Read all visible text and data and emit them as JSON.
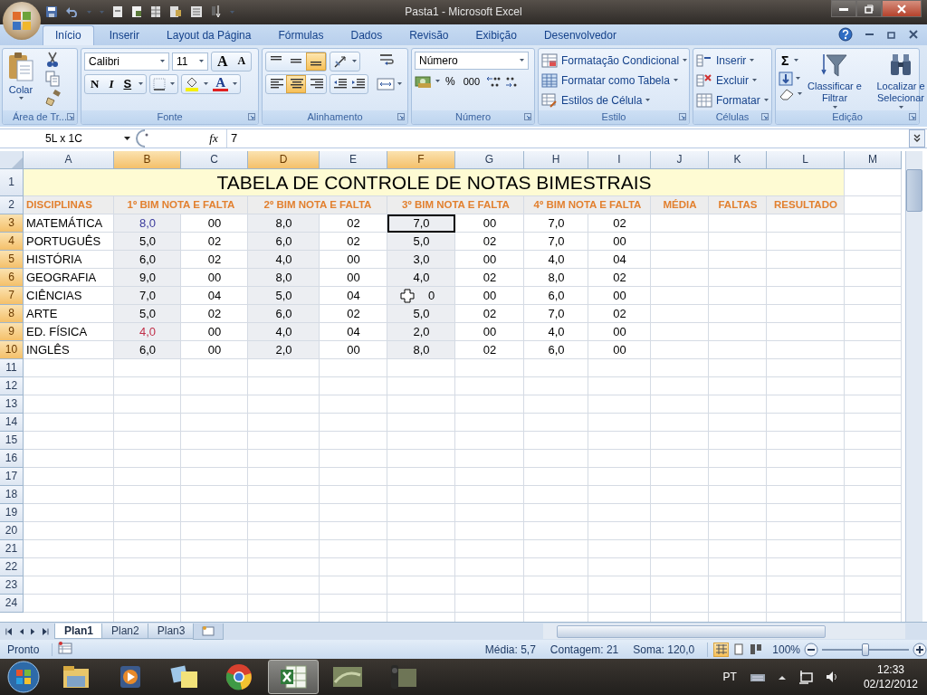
{
  "window": {
    "title": "Pasta1 - Microsoft Excel"
  },
  "ribbon_tabs": [
    {
      "label": "Início",
      "selected": true
    },
    {
      "label": "Inserir",
      "selected": false
    },
    {
      "label": "Layout da Página",
      "selected": false
    },
    {
      "label": "Fórmulas",
      "selected": false
    },
    {
      "label": "Dados",
      "selected": false
    },
    {
      "label": "Revisão",
      "selected": false
    },
    {
      "label": "Exibição",
      "selected": false
    },
    {
      "label": "Desenvolvedor",
      "selected": false
    }
  ],
  "clipboard": {
    "label": "Área de Tr...",
    "paste": "Colar"
  },
  "font": {
    "label": "Fonte",
    "name": "Calibri",
    "size": "11",
    "grow": "A",
    "shrink": "A",
    "bold": "N",
    "italic": "I",
    "underline": "S",
    "color_letter": "A"
  },
  "alignment": {
    "label": "Alinhamento",
    "vertical": [
      {
        "selected": false
      },
      {
        "selected": false
      },
      {
        "selected": true
      }
    ],
    "horizontal": [
      {
        "selected": false
      },
      {
        "selected": true
      },
      {
        "selected": false
      }
    ]
  },
  "number": {
    "label": "Número",
    "format": "Número",
    "percent": "%",
    "thousands": "000"
  },
  "styles": {
    "label": "Estilo",
    "items": [
      "Formatação Condicional",
      "Formatar como Tabela",
      "Estilos de Célula"
    ]
  },
  "cells": {
    "label": "Células",
    "items": [
      "Inserir",
      "Excluir",
      "Formatar"
    ]
  },
  "editing": {
    "label": "Edição",
    "sum": "Σ",
    "sort": "Classificar e Filtrar",
    "find": "Localizar e Selecionar"
  },
  "formula_bar": {
    "name_box": "5L x 1C",
    "function": "fx",
    "value": "7"
  },
  "sheet": {
    "columns": [
      {
        "label": "A",
        "selected": false
      },
      {
        "label": "B",
        "selected": true
      },
      {
        "label": "C",
        "selected": false
      },
      {
        "label": "D",
        "selected": true
      },
      {
        "label": "E",
        "selected": false
      },
      {
        "label": "F",
        "selected": true
      },
      {
        "label": "G",
        "selected": false
      },
      {
        "label": "H",
        "selected": false
      },
      {
        "label": "I",
        "selected": false
      },
      {
        "label": "J",
        "selected": false
      },
      {
        "label": "K",
        "selected": false
      },
      {
        "label": "L",
        "selected": false
      },
      {
        "label": "M",
        "selected": false
      }
    ],
    "rows": [
      {
        "number": "1",
        "selected": false,
        "kind": "title",
        "cells": [
          "TABELA DE CONTROLE DE NOTAS BIMESTRAIS"
        ]
      },
      {
        "number": "2",
        "selected": false,
        "kind": "header",
        "cells": [
          "DISCIPLINAS",
          {
            "text": "1º BIM  NOTA E FALTA",
            "kind": "merged"
          },
          {
            "text": "2º BIM  NOTA E FALTA",
            "kind": "merged"
          },
          {
            "text": "3º BIM  NOTA E FALTA",
            "kind": "merged"
          },
          {
            "text": "4º BIM  NOTA E FALTA",
            "kind": "merged"
          },
          "MÉDIA",
          "FALTAS",
          "RESULTADO"
        ]
      },
      {
        "number": "3",
        "selected": true,
        "kind": "data",
        "cells": [
          "MATEMÁTICA",
          {
            "text": "8,0",
            "color": "#3b3b9c"
          },
          "00",
          "8,0",
          "02",
          {
            "text": "7,0",
            "active": true
          },
          "00",
          "7,0",
          "02"
        ]
      },
      {
        "number": "4",
        "selected": true,
        "kind": "data",
        "cells": [
          "PORTUGUÊS",
          "5,0",
          "02",
          "6,0",
          "02",
          "5,0",
          "02",
          "7,0",
          "00"
        ]
      },
      {
        "number": "5",
        "selected": true,
        "kind": "data",
        "cells": [
          "HISTÓRIA",
          "6,0",
          "02",
          "4,0",
          "00",
          "3,0",
          "00",
          "4,0",
          "04"
        ]
      },
      {
        "number": "6",
        "selected": true,
        "kind": "data",
        "cells": [
          "GEOGRAFIA",
          "9,0",
          "00",
          "8,0",
          "00",
          "4,0",
          "02",
          "8,0",
          "02"
        ]
      },
      {
        "number": "7",
        "selected": true,
        "kind": "data",
        "cells": [
          "CIÊNCIAS",
          "7,0",
          "04",
          "5,0",
          "04",
          {
            "text": "0",
            "cursor": true
          },
          "00",
          "6,0",
          "00"
        ]
      },
      {
        "number": "8",
        "selected": true,
        "kind": "data",
        "cells": [
          "ARTE",
          "5,0",
          "02",
          "6,0",
          "02",
          "5,0",
          "02",
          "7,0",
          "02"
        ]
      },
      {
        "number": "9",
        "selected": true,
        "kind": "data",
        "cells": [
          "ED. FÍSICA",
          {
            "text": "4,0",
            "color": "#c0304a"
          },
          "00",
          "4,0",
          "04",
          "2,0",
          "00",
          "4,0",
          "00"
        ]
      },
      {
        "number": "10",
        "selected": true,
        "kind": "data",
        "cells": [
          "INGLÊS",
          "6,0",
          "00",
          "2,0",
          "00",
          "8,0",
          "02",
          "6,0",
          "00"
        ]
      },
      {
        "number": "11",
        "selected": false,
        "kind": "data"
      },
      {
        "number": "12",
        "selected": false,
        "kind": "data"
      },
      {
        "number": "13",
        "selected": false,
        "kind": "data"
      },
      {
        "number": "14",
        "selected": false,
        "kind": "data"
      },
      {
        "number": "15",
        "selected": false,
        "kind": "data"
      },
      {
        "number": "16",
        "selected": false,
        "kind": "data"
      },
      {
        "number": "17",
        "selected": false,
        "kind": "data"
      },
      {
        "number": "18",
        "selected": false,
        "kind": "data"
      },
      {
        "number": "19",
        "selected": false,
        "kind": "data"
      },
      {
        "number": "20",
        "selected": false,
        "kind": "data"
      },
      {
        "number": "21",
        "selected": false,
        "kind": "data"
      },
      {
        "number": "22",
        "selected": false,
        "kind": "data"
      },
      {
        "number": "23",
        "selected": false,
        "kind": "data"
      },
      {
        "number": "24",
        "selected": false,
        "kind": "data"
      }
    ]
  },
  "sheet_tabs": [
    {
      "label": "Plan1",
      "selected": true
    },
    {
      "label": "Plan2",
      "selected": false
    },
    {
      "label": "Plan3",
      "selected": false
    }
  ],
  "status_bar": {
    "mode": "Pronto",
    "stats": [
      "Média: 5,7",
      "Contagem: 21",
      "Soma: 120,0"
    ],
    "views": [
      {
        "selected": true
      },
      {
        "selected": false
      },
      {
        "selected": false
      }
    ],
    "zoom": {
      "text": "100%",
      "level": 0.5
    }
  },
  "taskbar": {
    "apps": [
      {
        "kind": "folder",
        "selected": false
      },
      {
        "kind": "player",
        "selected": false
      },
      {
        "kind": "notes",
        "selected": false
      },
      {
        "kind": "browser",
        "selected": false
      },
      {
        "kind": "spreadsheet",
        "selected": true
      },
      {
        "kind": "window",
        "selected": false
      },
      {
        "kind": "device",
        "selected": false
      }
    ],
    "language": "PT",
    "time": "12:33",
    "date": "02/12/2012"
  }
}
